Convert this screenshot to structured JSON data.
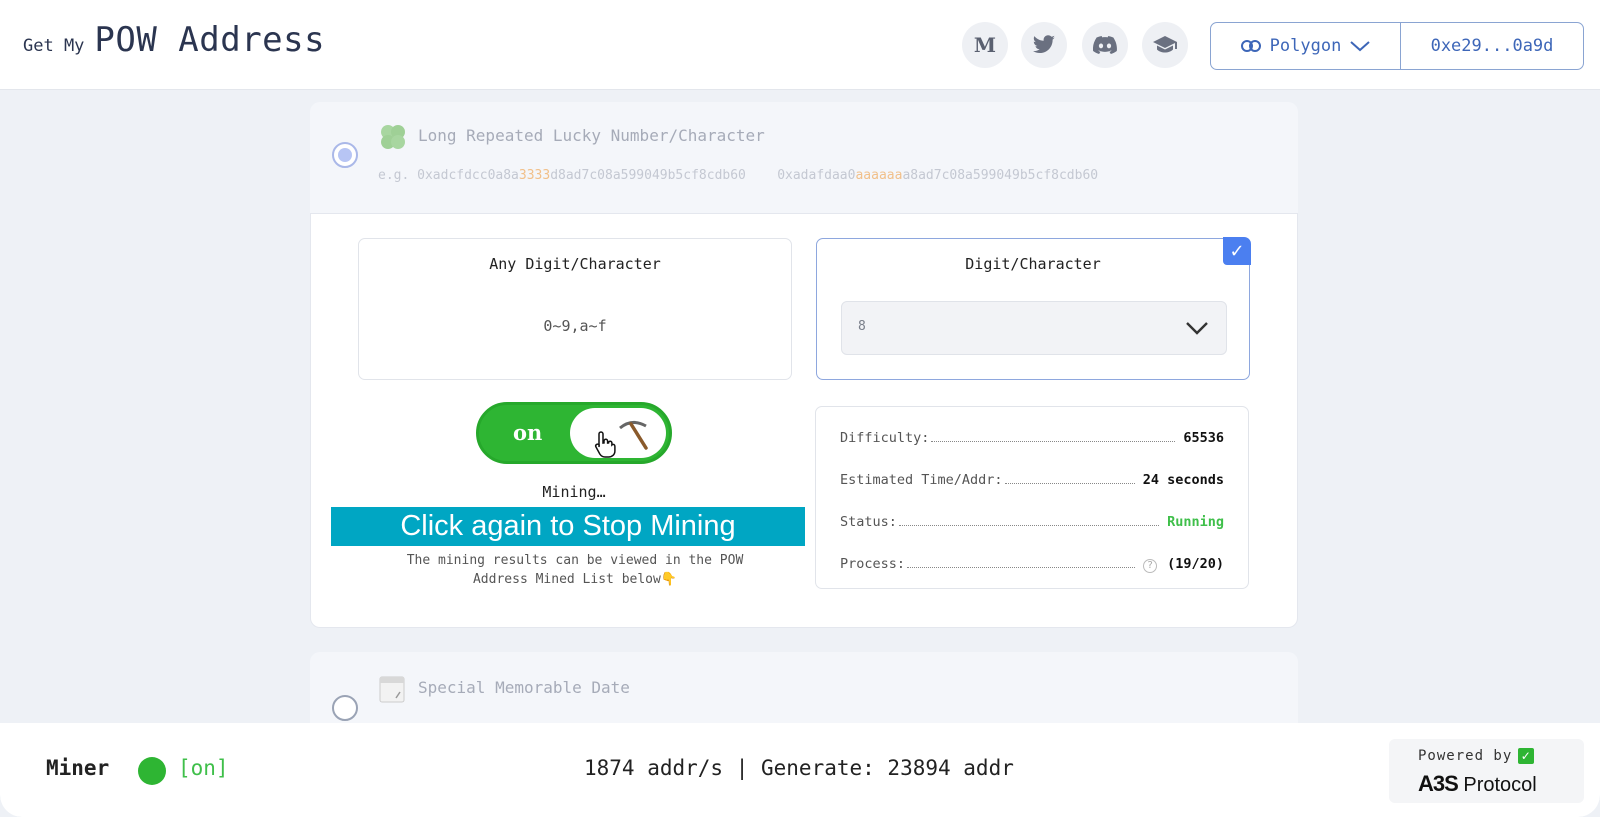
{
  "header": {
    "brand_small": "Get My",
    "brand_big": "POW Address",
    "social": [
      {
        "name": "medium-icon",
        "glyph": "M"
      },
      {
        "name": "twitter-icon",
        "glyph": ""
      },
      {
        "name": "discord-icon",
        "glyph": ""
      },
      {
        "name": "docs-icon",
        "glyph": ""
      }
    ],
    "network": "Polygon",
    "wallet_address": "0xe29...0a9d"
  },
  "option_lucky": {
    "title": "Long Repeated Lucky Number/Character",
    "example_prefix": "e.g.",
    "example1_a": "0xadcfdcc0a8a",
    "example1_hl": "3333",
    "example1_b": "d8ad7c08a599049b5cf8cdb60",
    "example2_a": "0xadafdaa0",
    "example2_hl": "aaaaaa",
    "example2_b": "a8ad7c08a599049b5cf8cdb60"
  },
  "card_any": {
    "title": "Any Digit/Character",
    "sub": "0~9,a~f"
  },
  "card_digit": {
    "title": "Digit/Character",
    "selected_value": "8"
  },
  "toggle": {
    "label": "on"
  },
  "mining_status_text": "Mining…",
  "banner_text": "Click again to Stop Mining",
  "hint": {
    "line1": "The mining results can be viewed in the POW",
    "line2": "Address Mined List below👇"
  },
  "stats": {
    "difficulty_label": "Difficulty:",
    "difficulty_value": "65536",
    "time_label": "Estimated Time/Addr:",
    "time_value": "24 seconds",
    "status_label": "Status:",
    "status_value": "Running",
    "process_label": "Process:",
    "process_help": "?",
    "process_value": "(19/20)"
  },
  "option_date": {
    "title": "Special Memorable Date"
  },
  "footer": {
    "miner_label": "Miner",
    "miner_state": "[on]",
    "rate_text": "1874 addr/s | Generate: 23894 addr",
    "powered_by": "Powered by",
    "protocol_logo": "A3S",
    "protocol_text": "Protocol"
  },
  "colors": {
    "accent_blue": "#4b7ff0",
    "mining_green": "#2eb533",
    "banner_cyan": "#00a6c3"
  }
}
